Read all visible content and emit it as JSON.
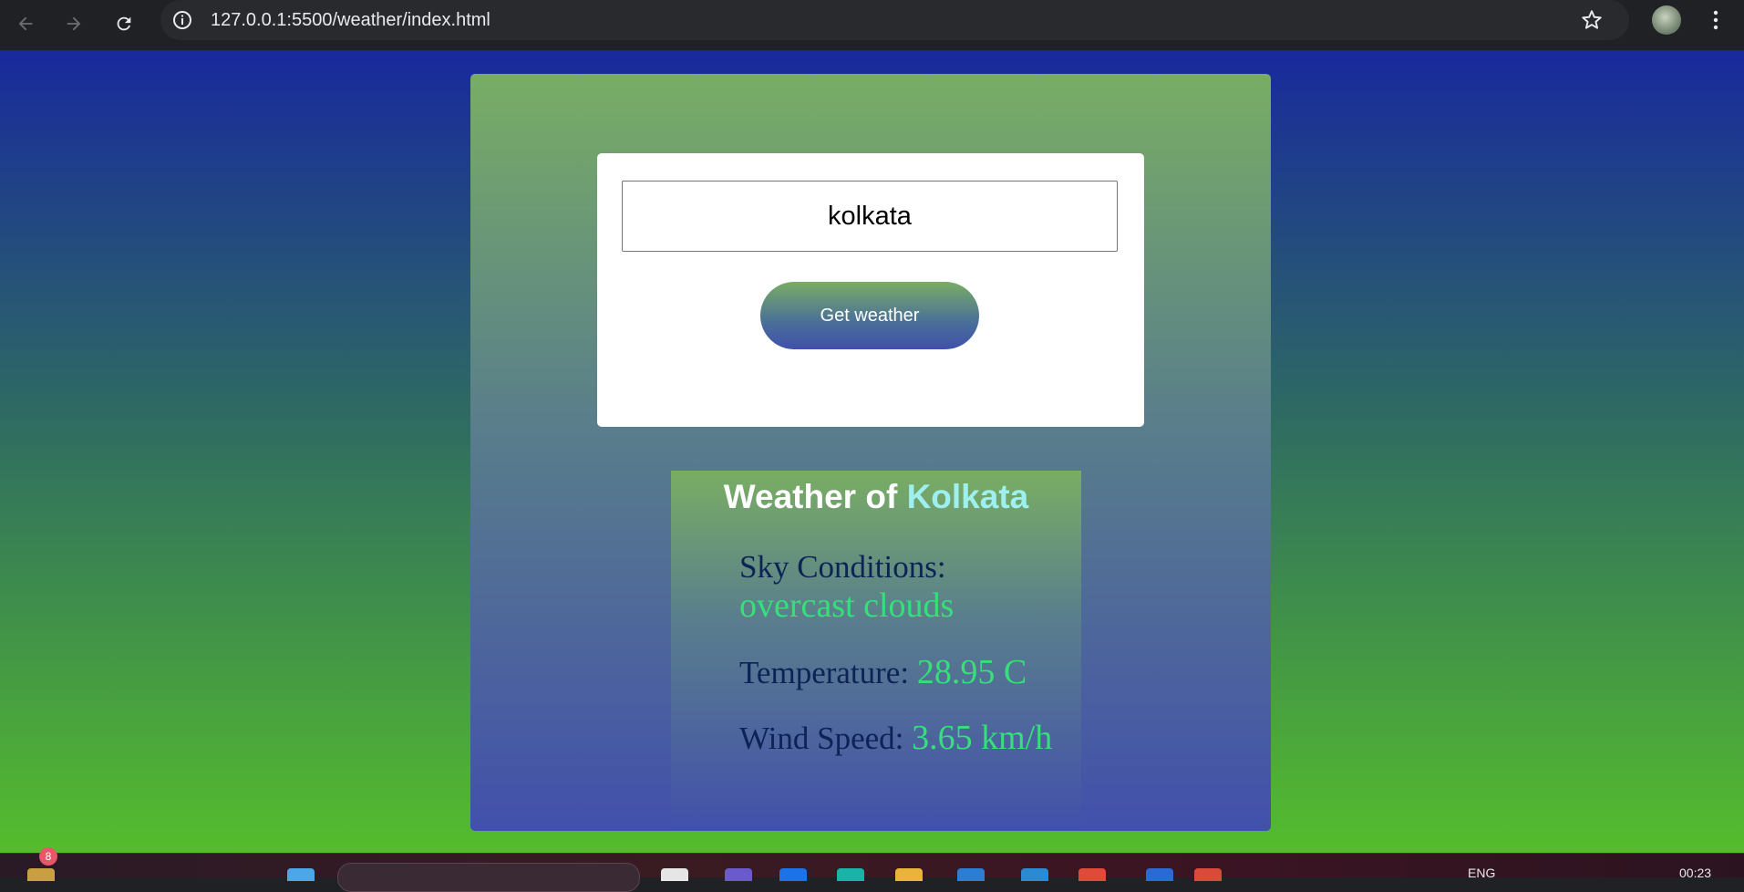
{
  "browser": {
    "url": "127.0.0.1:5500/weather/index.html",
    "icons": [
      "back-icon",
      "forward-icon",
      "reload-icon",
      "site-info-icon",
      "bookmark-star-icon",
      "profile-avatar",
      "more-menu-icon"
    ]
  },
  "app": {
    "search": {
      "value": "kolkata",
      "button_label": "Get weather"
    },
    "result": {
      "title_prefix": "Weather of ",
      "city": "Kolkata",
      "sky_label": "Sky Conditions: ",
      "sky_value": "overcast clouds",
      "temp_label": "Temperature: ",
      "temp_value": "28.95 C",
      "wind_label": "Wind Speed: ",
      "wind_value": "3.65 km/h"
    }
  },
  "taskbar": {
    "notification_count": "8",
    "language": "ENG",
    "time": "00:23"
  },
  "colors": {
    "page_gradient": [
      "#18299d",
      "#55bd2c"
    ],
    "card_gradient": [
      "#78ad65",
      "#4250ab"
    ],
    "value_color": "#35e07a",
    "city_color": "#9ef0ee"
  }
}
